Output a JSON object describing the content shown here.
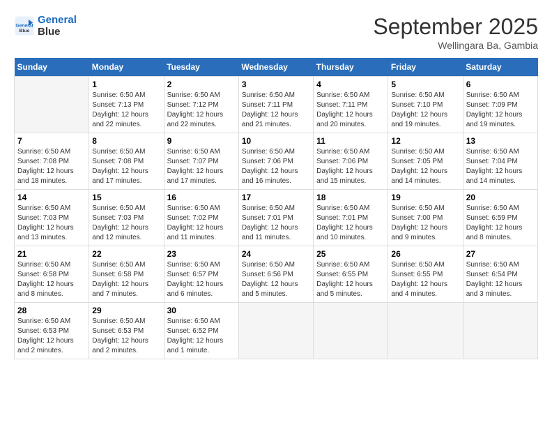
{
  "header": {
    "logo_line1": "General",
    "logo_line2": "Blue",
    "month": "September 2025",
    "location": "Wellingara Ba, Gambia"
  },
  "days_of_week": [
    "Sunday",
    "Monday",
    "Tuesday",
    "Wednesday",
    "Thursday",
    "Friday",
    "Saturday"
  ],
  "weeks": [
    [
      {
        "day": "",
        "info": ""
      },
      {
        "day": "1",
        "info": "Sunrise: 6:50 AM\nSunset: 7:13 PM\nDaylight: 12 hours\nand 22 minutes."
      },
      {
        "day": "2",
        "info": "Sunrise: 6:50 AM\nSunset: 7:12 PM\nDaylight: 12 hours\nand 22 minutes."
      },
      {
        "day": "3",
        "info": "Sunrise: 6:50 AM\nSunset: 7:11 PM\nDaylight: 12 hours\nand 21 minutes."
      },
      {
        "day": "4",
        "info": "Sunrise: 6:50 AM\nSunset: 7:11 PM\nDaylight: 12 hours\nand 20 minutes."
      },
      {
        "day": "5",
        "info": "Sunrise: 6:50 AM\nSunset: 7:10 PM\nDaylight: 12 hours\nand 19 minutes."
      },
      {
        "day": "6",
        "info": "Sunrise: 6:50 AM\nSunset: 7:09 PM\nDaylight: 12 hours\nand 19 minutes."
      }
    ],
    [
      {
        "day": "7",
        "info": "Sunrise: 6:50 AM\nSunset: 7:08 PM\nDaylight: 12 hours\nand 18 minutes."
      },
      {
        "day": "8",
        "info": "Sunrise: 6:50 AM\nSunset: 7:08 PM\nDaylight: 12 hours\nand 17 minutes."
      },
      {
        "day": "9",
        "info": "Sunrise: 6:50 AM\nSunset: 7:07 PM\nDaylight: 12 hours\nand 17 minutes."
      },
      {
        "day": "10",
        "info": "Sunrise: 6:50 AM\nSunset: 7:06 PM\nDaylight: 12 hours\nand 16 minutes."
      },
      {
        "day": "11",
        "info": "Sunrise: 6:50 AM\nSunset: 7:06 PM\nDaylight: 12 hours\nand 15 minutes."
      },
      {
        "day": "12",
        "info": "Sunrise: 6:50 AM\nSunset: 7:05 PM\nDaylight: 12 hours\nand 14 minutes."
      },
      {
        "day": "13",
        "info": "Sunrise: 6:50 AM\nSunset: 7:04 PM\nDaylight: 12 hours\nand 14 minutes."
      }
    ],
    [
      {
        "day": "14",
        "info": "Sunrise: 6:50 AM\nSunset: 7:03 PM\nDaylight: 12 hours\nand 13 minutes."
      },
      {
        "day": "15",
        "info": "Sunrise: 6:50 AM\nSunset: 7:03 PM\nDaylight: 12 hours\nand 12 minutes."
      },
      {
        "day": "16",
        "info": "Sunrise: 6:50 AM\nSunset: 7:02 PM\nDaylight: 12 hours\nand 11 minutes."
      },
      {
        "day": "17",
        "info": "Sunrise: 6:50 AM\nSunset: 7:01 PM\nDaylight: 12 hours\nand 11 minutes."
      },
      {
        "day": "18",
        "info": "Sunrise: 6:50 AM\nSunset: 7:01 PM\nDaylight: 12 hours\nand 10 minutes."
      },
      {
        "day": "19",
        "info": "Sunrise: 6:50 AM\nSunset: 7:00 PM\nDaylight: 12 hours\nand 9 minutes."
      },
      {
        "day": "20",
        "info": "Sunrise: 6:50 AM\nSunset: 6:59 PM\nDaylight: 12 hours\nand 8 minutes."
      }
    ],
    [
      {
        "day": "21",
        "info": "Sunrise: 6:50 AM\nSunset: 6:58 PM\nDaylight: 12 hours\nand 8 minutes."
      },
      {
        "day": "22",
        "info": "Sunrise: 6:50 AM\nSunset: 6:58 PM\nDaylight: 12 hours\nand 7 minutes."
      },
      {
        "day": "23",
        "info": "Sunrise: 6:50 AM\nSunset: 6:57 PM\nDaylight: 12 hours\nand 6 minutes."
      },
      {
        "day": "24",
        "info": "Sunrise: 6:50 AM\nSunset: 6:56 PM\nDaylight: 12 hours\nand 5 minutes."
      },
      {
        "day": "25",
        "info": "Sunrise: 6:50 AM\nSunset: 6:55 PM\nDaylight: 12 hours\nand 5 minutes."
      },
      {
        "day": "26",
        "info": "Sunrise: 6:50 AM\nSunset: 6:55 PM\nDaylight: 12 hours\nand 4 minutes."
      },
      {
        "day": "27",
        "info": "Sunrise: 6:50 AM\nSunset: 6:54 PM\nDaylight: 12 hours\nand 3 minutes."
      }
    ],
    [
      {
        "day": "28",
        "info": "Sunrise: 6:50 AM\nSunset: 6:53 PM\nDaylight: 12 hours\nand 2 minutes."
      },
      {
        "day": "29",
        "info": "Sunrise: 6:50 AM\nSunset: 6:53 PM\nDaylight: 12 hours\nand 2 minutes."
      },
      {
        "day": "30",
        "info": "Sunrise: 6:50 AM\nSunset: 6:52 PM\nDaylight: 12 hours\nand 1 minute."
      },
      {
        "day": "",
        "info": ""
      },
      {
        "day": "",
        "info": ""
      },
      {
        "day": "",
        "info": ""
      },
      {
        "day": "",
        "info": ""
      }
    ]
  ]
}
